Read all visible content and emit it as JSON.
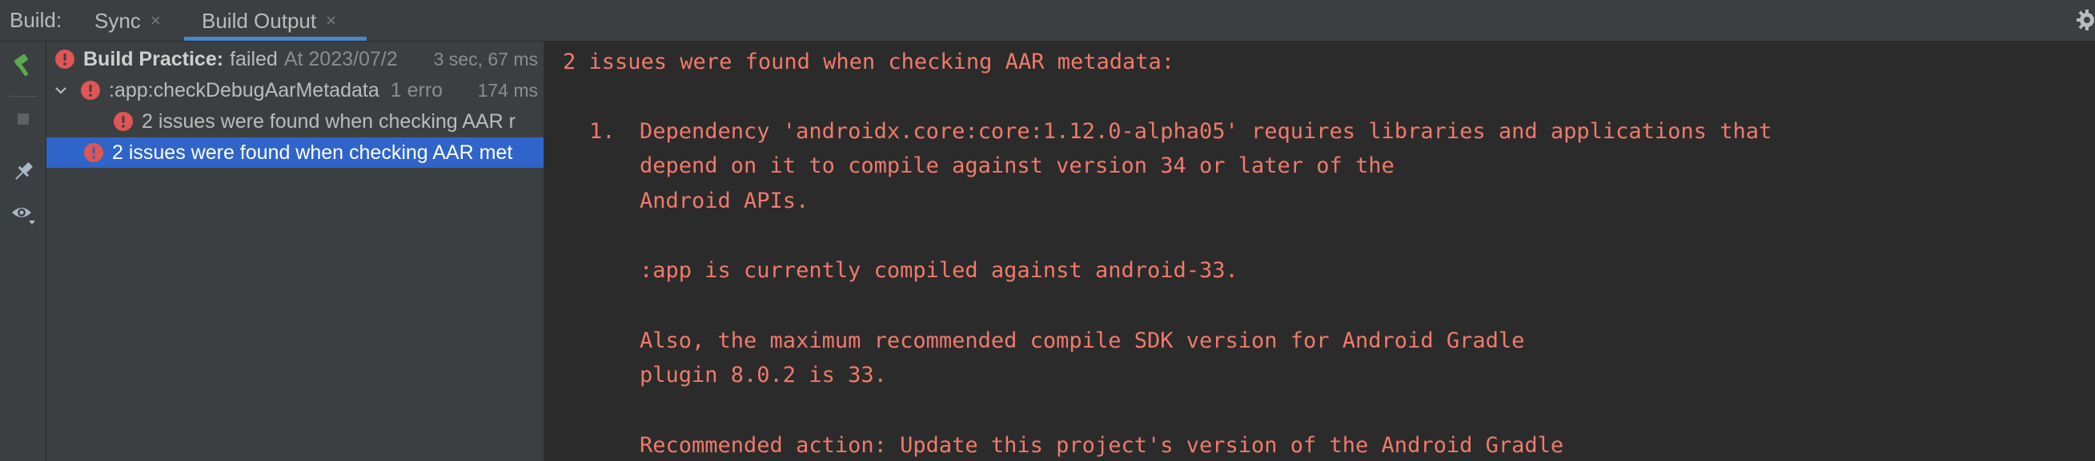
{
  "tabbar": {
    "build_label": "Build:",
    "tabs": [
      {
        "label": "Sync",
        "close": "×"
      },
      {
        "label": "Build Output",
        "close": "×",
        "active": true
      }
    ],
    "settings_icon": "gear-icon"
  },
  "toolbar": {
    "icons": [
      "hammer-icon",
      "stop-icon",
      "pin-icon",
      "eye-icon"
    ]
  },
  "tree": {
    "root": {
      "title": "Build Practice:",
      "status": "failed",
      "time_label": "At 2023/07/2",
      "duration": "3 sec, 67 ms",
      "icon": "error-icon"
    },
    "task": {
      "title": ":app:checkDebugAarMetadata",
      "errors": "1 erro",
      "duration": "174 ms",
      "icon": "error-icon",
      "expand_icon": "chevron-down-icon"
    },
    "issue_child": "2 issues were found when checking AAR r",
    "issue_selected": "2 issues were found when checking AAR met"
  },
  "console": {
    "header": "2 issues were found when checking AAR metadata:",
    "item_number": "1.",
    "lines": [
      "Dependency 'androidx.core:core:1.12.0-alpha05' requires libraries and applications that",
      "depend on it to compile against version 34 or later of the",
      "Android APIs.",
      ":app is currently compiled against android-33.",
      "Also, the maximum recommended compile SDK version for Android Gradle",
      "plugin 8.0.2 is 33.",
      "Recommended action: Update this project's version of the Android Gradle"
    ],
    "text_color": "#f07a6b"
  },
  "colors": {
    "panel_bg": "#3c3f41",
    "console_bg": "#2b2b2b",
    "selection": "#2f65ca",
    "tab_underline": "#4a88c7",
    "error_red": "#e05555",
    "hammer_green": "#5ca94f"
  }
}
